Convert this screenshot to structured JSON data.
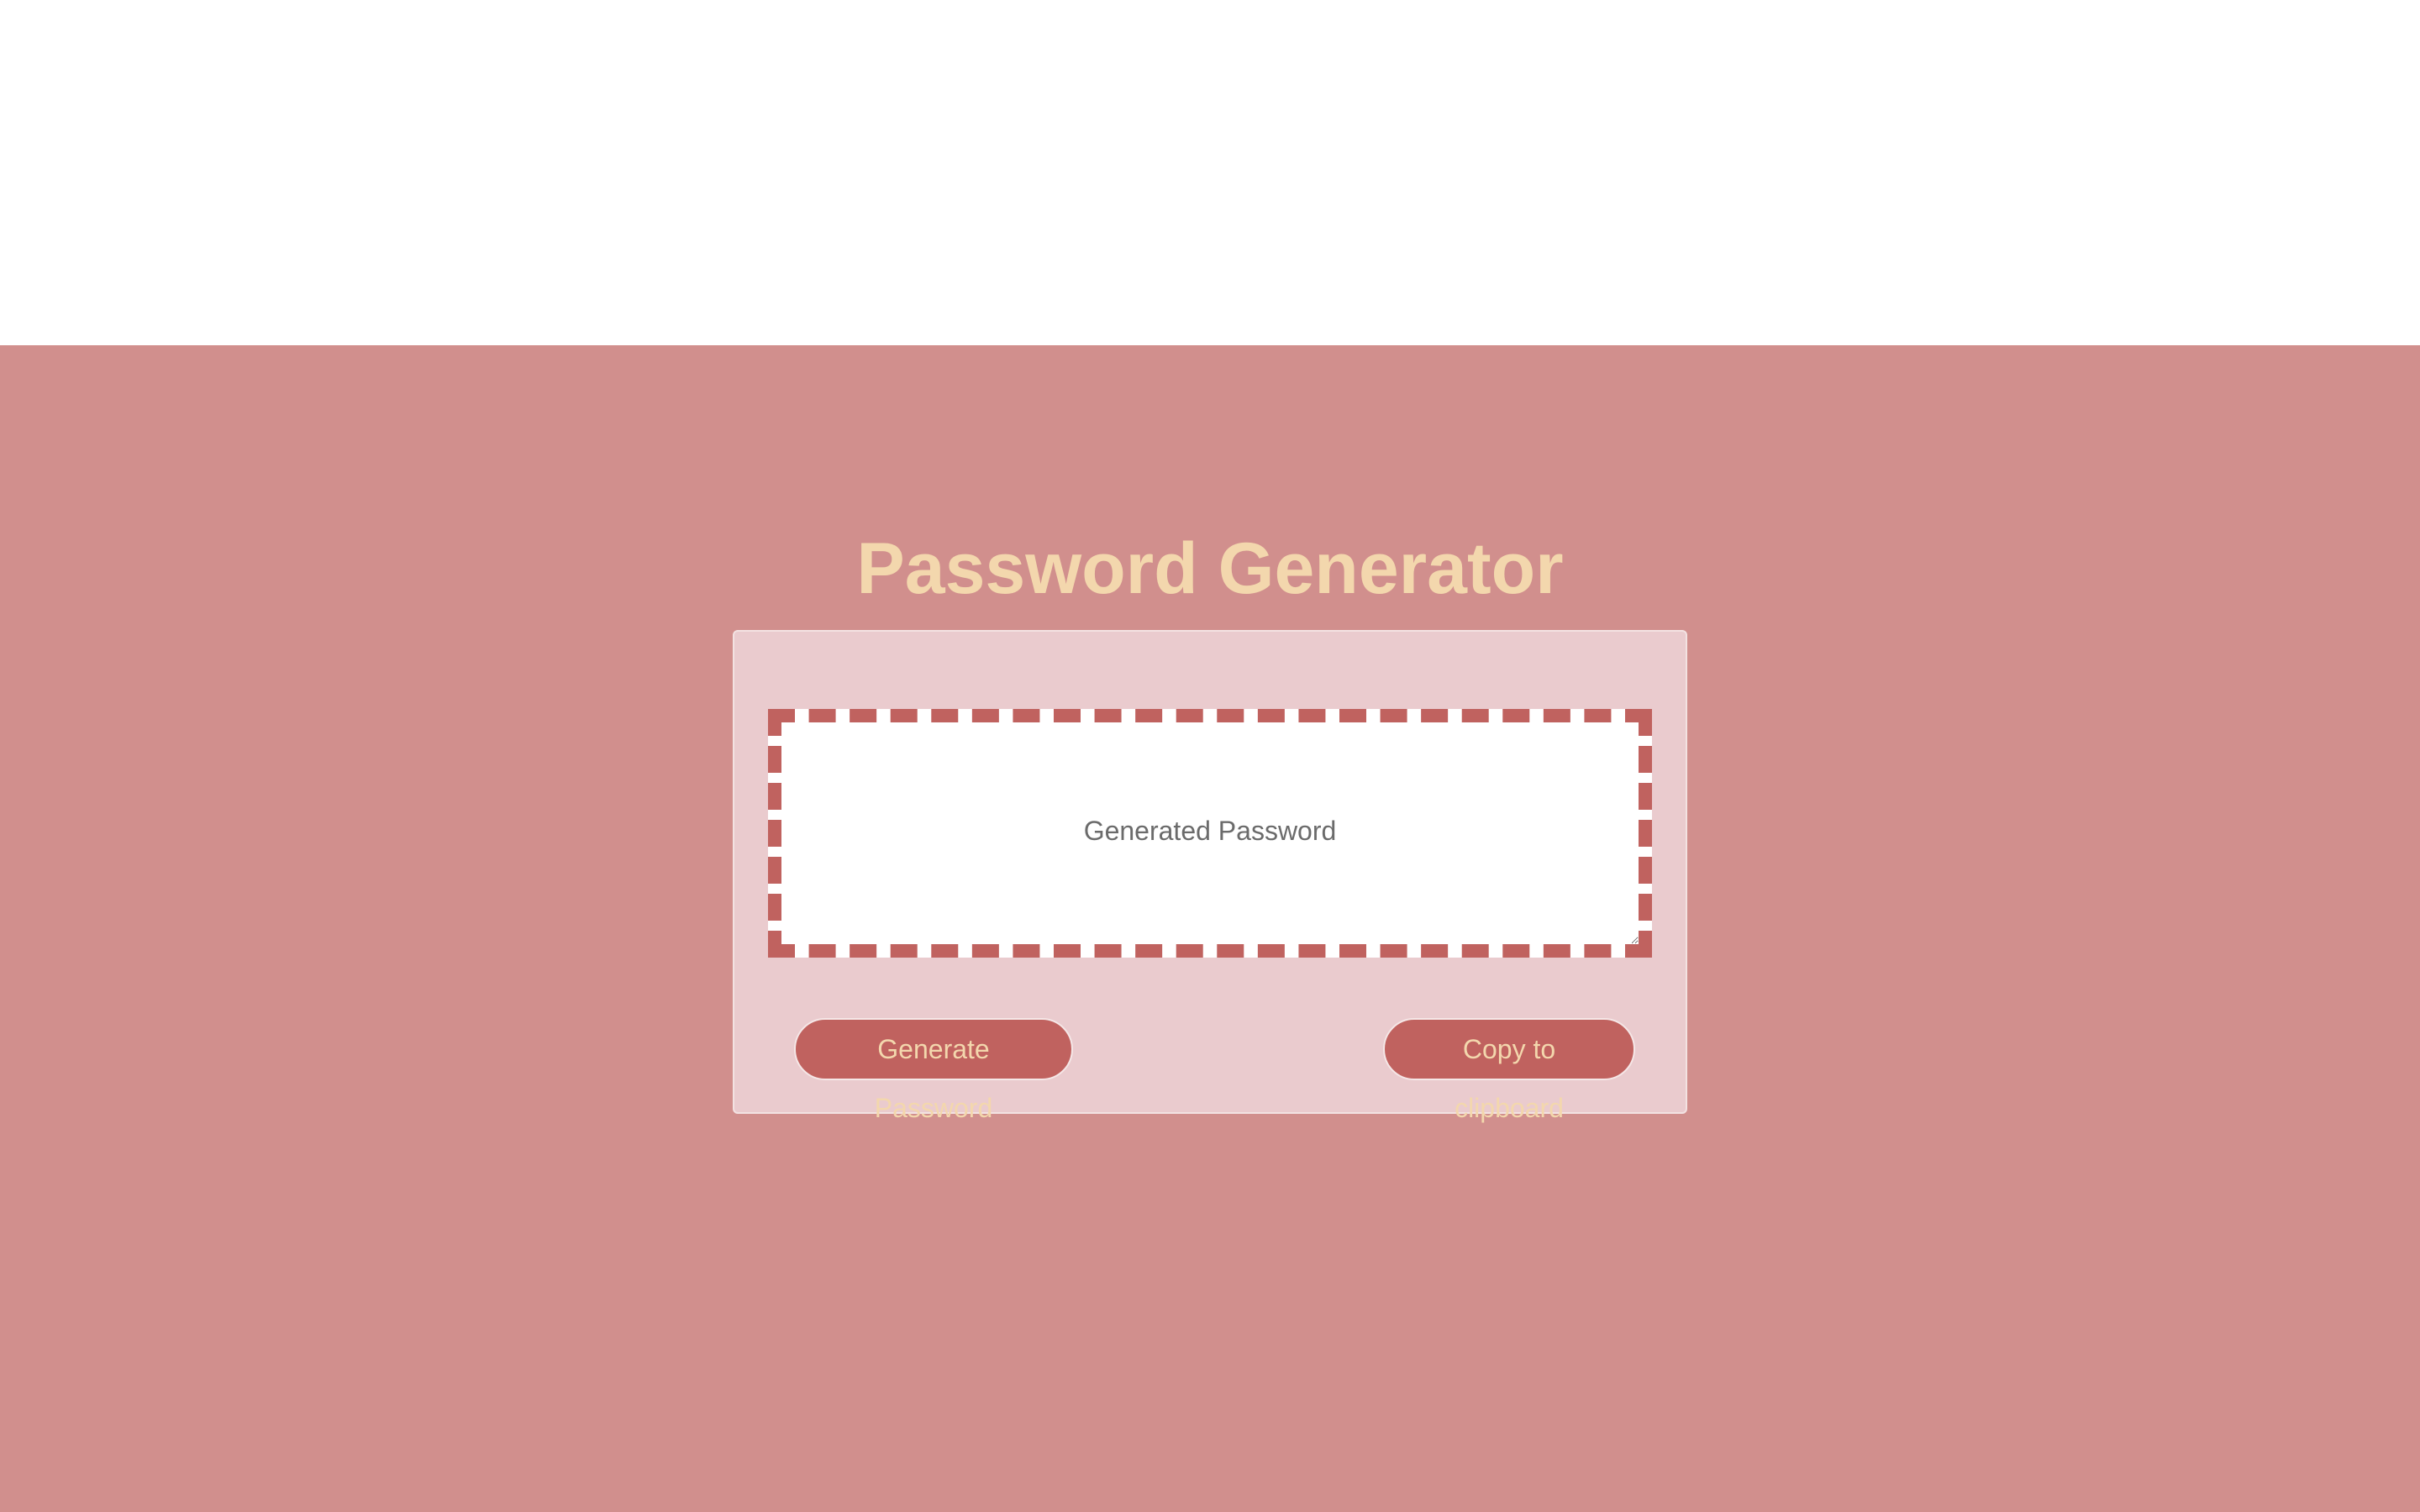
{
  "header": {
    "title": "Password Generator"
  },
  "card": {
    "password": {
      "value": "",
      "placeholder": "Generated Password"
    },
    "generate_label": "Generate Password",
    "copy_label": "Copy to clipboard"
  },
  "colors": {
    "background": "#d18f8d",
    "card": "#eacbce",
    "accent": "#c0625f",
    "title": "#f3d7ad"
  }
}
